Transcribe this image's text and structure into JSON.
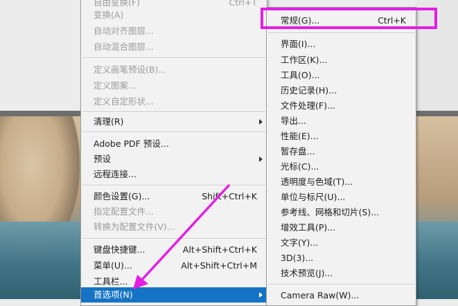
{
  "main_menu": {
    "items": [
      {
        "label": "自由变换(F)",
        "shortcut": "Ctrl+T",
        "disabled": true
      },
      {
        "label": "变换(A)",
        "disabled": true
      },
      {
        "label": "自动对齐图层...",
        "disabled": true
      },
      {
        "label": "自动混合图层...",
        "disabled": true
      },
      {
        "label": "定义画笔预设(B)...",
        "disabled": true
      },
      {
        "label": "定义图案...",
        "disabled": true
      },
      {
        "label": "定义自定形状...",
        "disabled": true
      },
      {
        "label": "清理(R)",
        "submenu": true
      },
      {
        "label": "Adobe PDF 预设..."
      },
      {
        "label": "预设",
        "submenu": true
      },
      {
        "label": "远程连接..."
      },
      {
        "label": "颜色设置(G)...",
        "shortcut": "Shift+Ctrl+K"
      },
      {
        "label": "指定配置文件...",
        "disabled": true
      },
      {
        "label": "转换为配置文件(V)...",
        "disabled": true
      },
      {
        "label": "键盘快捷键...",
        "shortcut": "Alt+Shift+Ctrl+K"
      },
      {
        "label": "菜单(U)...",
        "shortcut": "Alt+Shift+Ctrl+M"
      },
      {
        "label": "工具栏..."
      },
      {
        "label": "首选项(N)",
        "submenu": true,
        "active": true
      }
    ]
  },
  "sub_menu": {
    "items": [
      {
        "label": "常规(G)...",
        "shortcut": "Ctrl+K"
      },
      {
        "label": "界面(I)..."
      },
      {
        "label": "工作区(K)..."
      },
      {
        "label": "工具(O)..."
      },
      {
        "label": "历史记录(H)..."
      },
      {
        "label": "文件处理(F)..."
      },
      {
        "label": "导出..."
      },
      {
        "label": "性能(E)..."
      },
      {
        "label": "暂存盘..."
      },
      {
        "label": "光标(C)..."
      },
      {
        "label": "透明度与色域(T)..."
      },
      {
        "label": "单位与标尺(U)..."
      },
      {
        "label": "参考线、网格和切片(S)..."
      },
      {
        "label": "增效工具(P)..."
      },
      {
        "label": "文字(Y)..."
      },
      {
        "label": "3D(3)..."
      },
      {
        "label": "技术预览(J)..."
      },
      {
        "label": "Camera Raw(W)..."
      }
    ]
  },
  "colors": {
    "highlight": "#e31ee3",
    "active_item": "#1573c5"
  }
}
